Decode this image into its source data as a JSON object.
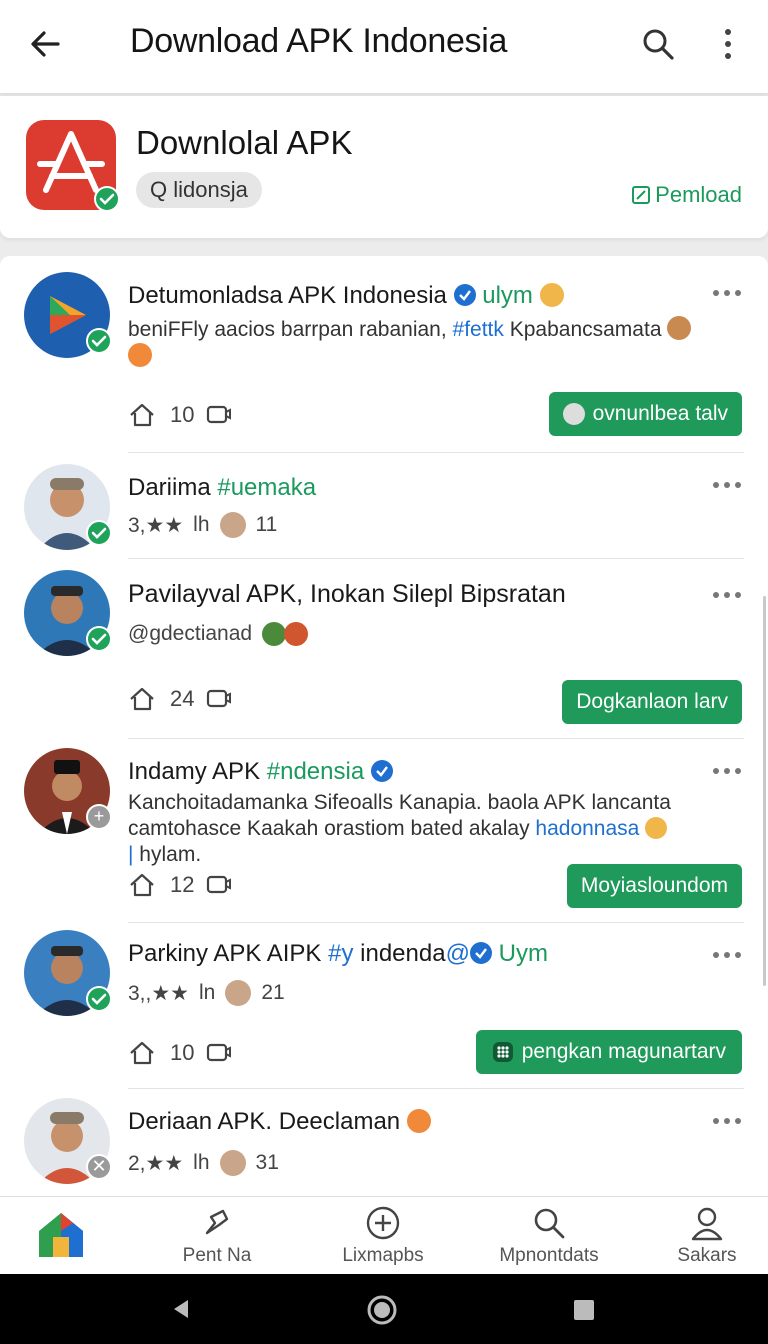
{
  "appbar": {
    "title": "Download APK Indonesia",
    "back_icon": "back-arrow-icon",
    "search_icon": "search-icon",
    "more_icon": "more-vert-icon"
  },
  "header": {
    "app_name": "Downlolal APK",
    "chip": "Q lidonsja",
    "pemload": "Pemload"
  },
  "posts": [
    {
      "name": "Detumonladsa APK Indonesia",
      "name_tag": "ulym",
      "text_1": "beniFFly aacios barrpan rabanian, ",
      "tag": "#fettk",
      "text_2": " Kpabancsamata",
      "count": "10",
      "cta": "ovnunlbea talv"
    },
    {
      "name": "Dariima",
      "name_tag": "#uemaka",
      "meta_left": "3,★★",
      "meta_mid": "lh",
      "meta_count": "11"
    },
    {
      "name": "Pavilayval APK, Inokan Silepl Bipsratan",
      "handle": "@gdectianad",
      "count": "24",
      "cta": "Dogkanlaon larv"
    },
    {
      "name": "Indamy APK",
      "name_tag": "#ndensia",
      "line_1": "Kanchoitadamanka  Sifeoalls Kanapia. baola APK lancanta",
      "line_2a": "camtohasce Kaakah orastiom bated akalay ",
      "line_2b": "hadonnasa",
      "line_3a": "| ",
      "line_3b": "hylam.",
      "count": "12",
      "cta": "Moyiasloundom"
    },
    {
      "name": "Parkiny APK AIPK",
      "name_tag": "#y",
      "name_rest": "indenda",
      "name_tag2": "@",
      "name_tag3": "Uym",
      "meta_left": "3,,★★",
      "meta_mid": "ln",
      "meta_count": "21",
      "count": "10",
      "cta": "pengkan magunartarv"
    },
    {
      "name": "Deriaan APK. Deeclaman",
      "meta_left": "2,★★",
      "meta_mid": "lh",
      "meta_count": "31"
    }
  ],
  "nav": [
    {
      "label": "",
      "icon": "home-app-icon"
    },
    {
      "label": "Pent Na",
      "icon": "pin-icon"
    },
    {
      "label": "Lixmapbs",
      "icon": "add-circle-icon"
    },
    {
      "label": "Mpnontdats",
      "icon": "search-icon"
    },
    {
      "label": "Sakars",
      "icon": "person-icon"
    }
  ],
  "colors": {
    "accent_green": "#1f9a5a",
    "link_blue": "#1e6fd0",
    "logo_red": "#dc3b2f"
  }
}
